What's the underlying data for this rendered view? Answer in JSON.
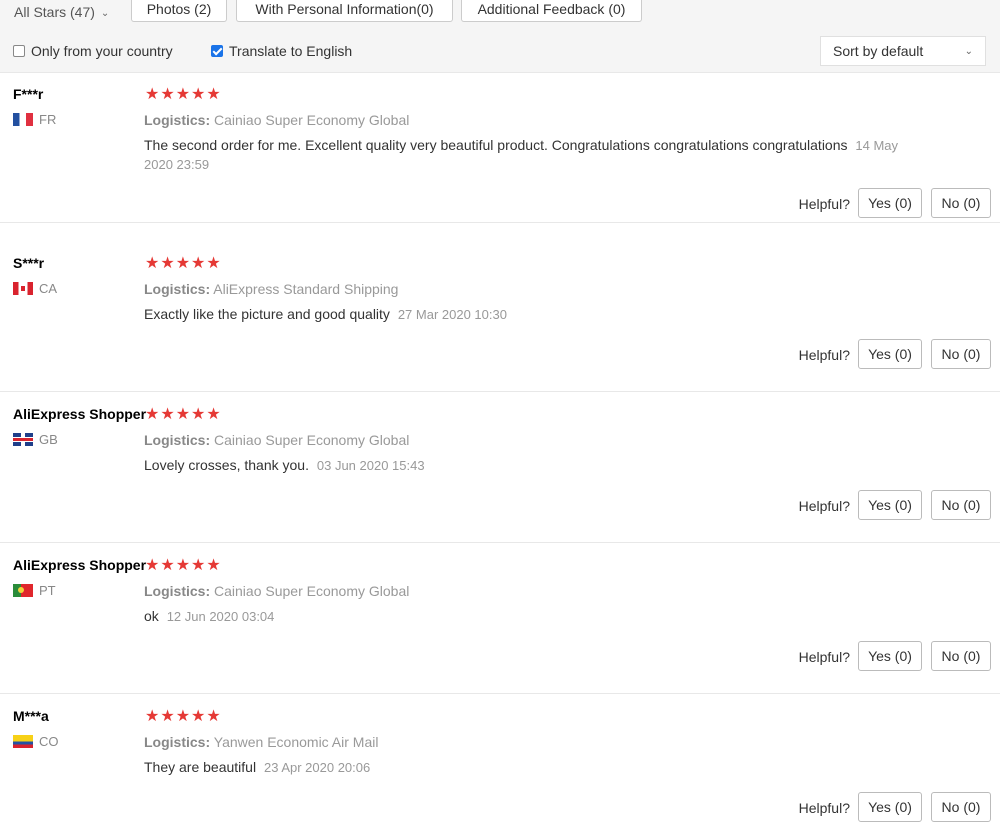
{
  "filters": {
    "all_stars": "All Stars (47)",
    "tabs": [
      "Photos (2)",
      "With Personal Information(0)",
      "Additional Feedback (0)"
    ]
  },
  "options": {
    "only_country": "Only from your country",
    "only_country_checked": false,
    "translate": "Translate to English",
    "translate_checked": true,
    "sort": "Sort by default"
  },
  "helpful_label": "Helpful?",
  "logistics_label": "Logistics:",
  "reviews": [
    {
      "user": "F***r",
      "country": "FR",
      "stars": 5,
      "logistics": "Cainiao Super Economy Global",
      "text": "The second order for me. Excellent quality very beautiful product. Congratulations congratulations congratulations",
      "date": "14 May 2020 23:59",
      "yes": "Yes (0)",
      "no": "No (0)"
    },
    {
      "user": "S***r",
      "country": "CA",
      "stars": 5,
      "logistics": "AliExpress Standard Shipping",
      "text": "Exactly like the picture and good quality",
      "date": "27 Mar 2020 10:30",
      "yes": "Yes (0)",
      "no": "No (0)"
    },
    {
      "user": "AliExpress Shopper",
      "country": "GB",
      "stars": 5,
      "logistics": "Cainiao Super Economy Global",
      "text": "Lovely crosses, thank you.",
      "date": "03 Jun 2020 15:43",
      "yes": "Yes (0)",
      "no": "No (0)"
    },
    {
      "user": "AliExpress Shopper",
      "country": "PT",
      "stars": 5,
      "logistics": "Cainiao Super Economy Global",
      "text": "ok",
      "date": "12 Jun 2020 03:04",
      "yes": "Yes (0)",
      "no": "No (0)"
    },
    {
      "user": "M***a",
      "country": "CO",
      "stars": 5,
      "logistics": "Yanwen Economic Air Mail",
      "text": "They are beautiful",
      "date": "23 Apr 2020 20:06",
      "yes": "Yes (0)",
      "no": "No (0)"
    }
  ]
}
